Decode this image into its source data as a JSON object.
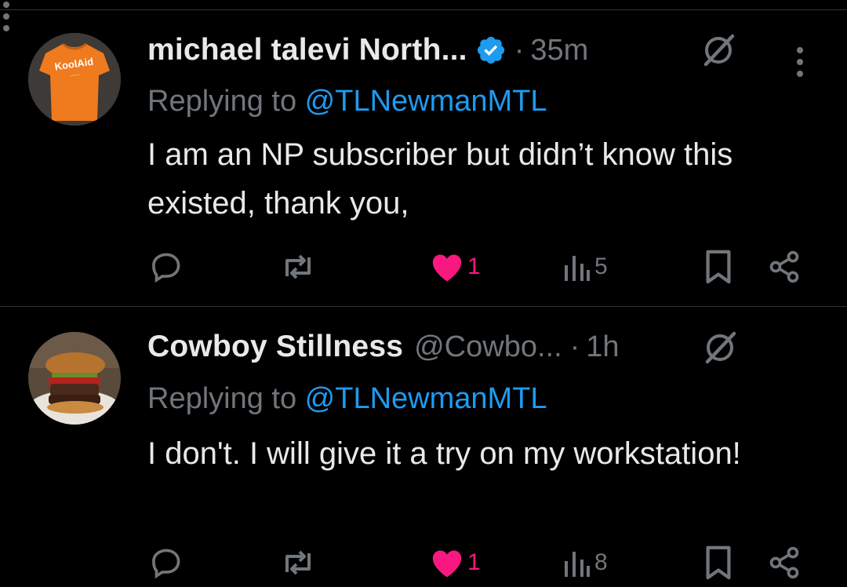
{
  "colors": {
    "background": "#000000",
    "text": "#e7e9ea",
    "muted": "#71767b",
    "link": "#1d9bf0",
    "like": "#f91880",
    "verified": "#1d9bf0"
  },
  "replies": [
    {
      "author_name": "michael talevi North...",
      "verified": true,
      "handle": "",
      "separator": "·",
      "time": "35m",
      "replying_prefix": "Replying to ",
      "replying_to": "@TLNewmanMTL",
      "text": "I am an NP subscriber but didn’t know this existed, thank you,",
      "avatar": "orange-shirt-avatar",
      "avatar_text": "KoolAid",
      "likes": "1",
      "views": "5",
      "liked": true
    },
    {
      "author_name": "Cowboy Stillness",
      "verified": false,
      "handle": "@Cowbo...",
      "separator": "·",
      "time": "1h",
      "replying_prefix": "Replying to ",
      "replying_to": "@TLNewmanMTL",
      "text": "I don't. I will give it a try on my workstation!",
      "avatar": "burger-avatar",
      "likes": "1",
      "views": "8",
      "liked": true
    }
  ],
  "icons": {
    "reply": "reply-icon",
    "repost": "repost-icon",
    "like": "heart-icon",
    "views": "views-icon",
    "bookmark": "bookmark-icon",
    "share": "share-icon",
    "grok": "grok-icon",
    "more": "more-icon",
    "verified": "verified-badge-icon"
  }
}
